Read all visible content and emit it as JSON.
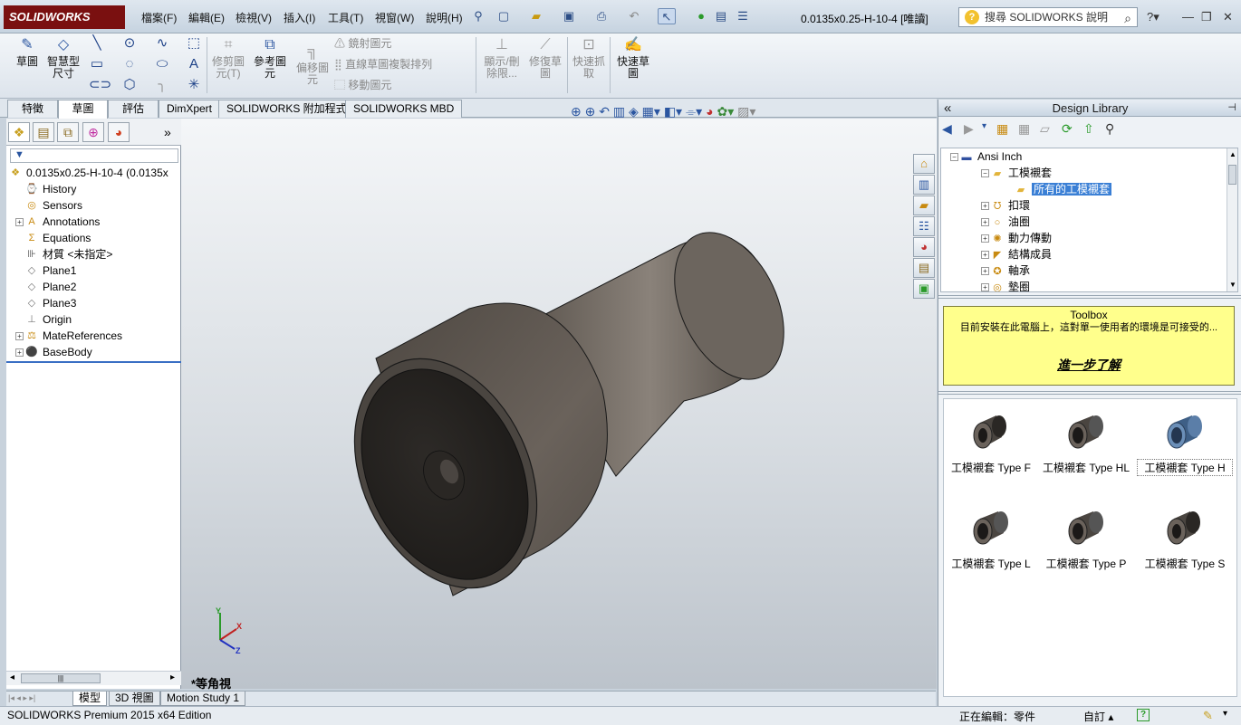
{
  "app": {
    "brand": "SOLIDWORKS",
    "document_title": "0.0135x0.25-H-10-4 [唯讀]"
  },
  "menu": [
    "檔案(F)",
    "編輯(E)",
    "檢視(V)",
    "插入(I)",
    "工具(T)",
    "視窗(W)",
    "說明(H)"
  ],
  "help_search": {
    "placeholder": "搜尋 SOLIDWORKS 說明"
  },
  "command_manager": {
    "sketch": "草圖",
    "smart_dim_line1": "智慧型",
    "smart_dim_line2": "尺寸",
    "trim_line1": "修剪圖",
    "trim_line2": "元(T)",
    "convert_line1": "參考圖",
    "convert_line2": "元",
    "offset_line1": "偏移圖",
    "offset_line2": "元",
    "mirror": "鏡射圖元",
    "linear_pattern": "直線草圖複製排列",
    "move": "移動圖元",
    "show_delete_line1": "顯示/刪",
    "show_delete_line2": "除限...",
    "repair_line1": "修復草",
    "repair_line2": "圖",
    "quick_snap_line1": "快速抓",
    "quick_snap_line2": "取",
    "rapid_sketch_line1": "快速草",
    "rapid_sketch_line2": "圖"
  },
  "cm_tabs": [
    "特徵",
    "草圖",
    "評估",
    "DimXpert",
    "SOLIDWORKS 附加程式",
    "SOLIDWORKS MBD"
  ],
  "feature_tree": {
    "root": "0.0135x0.25-H-10-4  (0.0135x",
    "items": [
      "History",
      "Sensors",
      "Annotations",
      "Equations",
      "材質 <未指定>",
      "Plane1",
      "Plane2",
      "Plane3",
      "Origin",
      "MateReferences",
      "BaseBody"
    ]
  },
  "viewport": {
    "view_name": "*等角視",
    "triad": {
      "x": "X",
      "y": "Y",
      "z": "Z"
    }
  },
  "bottom_tabs": [
    "模型",
    "3D 視圖",
    "Motion Study 1"
  ],
  "status": {
    "edition": "SOLIDWORKS Premium 2015 x64 Edition",
    "editing": "正在編輯：零件",
    "units": "自訂"
  },
  "design_library": {
    "title": "Design Library",
    "tree": [
      "Ansi Inch",
      "工模襯套",
      "所有的工模襯套",
      "扣環",
      "油圈",
      "動力傳動",
      "結構成員",
      "軸承",
      "墊圈"
    ],
    "toolbox_title": "Toolbox",
    "toolbox_body": "目前安裝在此電腦上，這對單一使用者的環境是可接受的...",
    "toolbox_link": "進一步了解",
    "items": [
      "工模襯套 Type F",
      "工模襯套 Type HL",
      "工模襯套 Type H",
      "工模襯套 Type L",
      "工模襯套 Type P",
      "工模襯套 Type S"
    ]
  }
}
